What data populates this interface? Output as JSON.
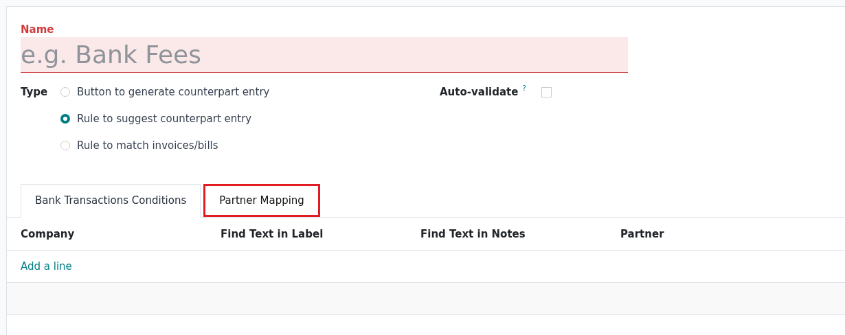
{
  "name_field": {
    "label": "Name",
    "placeholder": "e.g. Bank Fees",
    "required": true
  },
  "type": {
    "label": "Type",
    "options": [
      {
        "label": "Button to generate counterpart entry",
        "selected": false
      },
      {
        "label": "Rule to suggest counterpart entry",
        "selected": true
      },
      {
        "label": "Rule to match invoices/bills",
        "selected": false
      }
    ]
  },
  "auto_validate": {
    "label": "Auto-validate",
    "help": "?",
    "checked": false
  },
  "tabs": [
    {
      "label": "Bank Transactions Conditions",
      "selected": true,
      "highlighted": false
    },
    {
      "label": "Partner Mapping",
      "selected": false,
      "highlighted": true
    }
  ],
  "table": {
    "columns": [
      "Company",
      "Find Text in Label",
      "Find Text in Notes",
      "Partner"
    ],
    "add_line": "Add a line"
  }
}
